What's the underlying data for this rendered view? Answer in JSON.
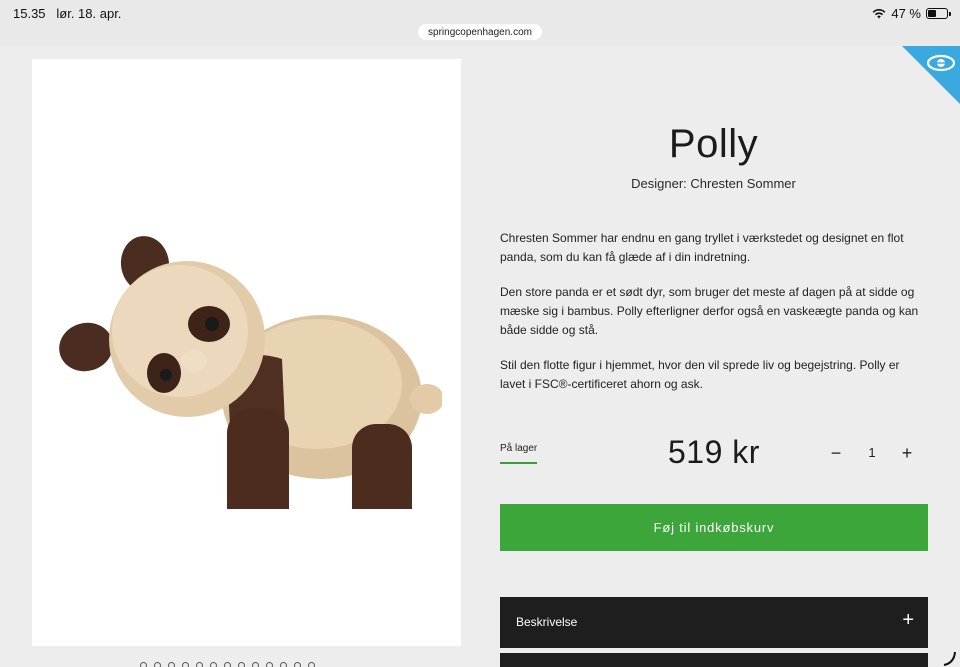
{
  "status_bar": {
    "time": "15.35",
    "date": "lør. 18. apr.",
    "battery": "47 %",
    "battery_level": 0.47,
    "url": "springcopenhagen.com"
  },
  "product": {
    "title": "Polly",
    "designer": "Designer: Chresten Sommer",
    "description": [
      "Chresten Sommer har endnu en gang tryllet i værkstedet og designet en flot panda, som du kan få glæde af i din indretning.",
      "Den store panda er et sødt dyr, som bruger det meste af dagen på at sidde og mæske sig i bambus. Polly efterligner derfor også en vaskeægte panda og kan både sidde og stå.",
      "Stil den flotte figur i hjemmet, hvor den vil sprede liv og begejstring. Polly er lavet i FSC®-certificeret ahorn og ask."
    ],
    "stock_status": "På lager",
    "price": "519 kr",
    "quantity": "1",
    "qty_minus": "−",
    "qty_plus": "+"
  },
  "actions": {
    "add_to_cart": "Føj til indkøbskurv"
  },
  "accordion": {
    "description_label": "Beskrivelse",
    "expand_icon": "+"
  },
  "gallery": {
    "dot_count": 13
  },
  "colors": {
    "accent_green": "#3da63a",
    "badge_blue": "#3aa9df",
    "dark_panel": "#1e1e1e"
  },
  "icons": [
    "wifi-icon",
    "battery-icon",
    "eye-icon",
    "plus-icon",
    "minus-icon"
  ]
}
